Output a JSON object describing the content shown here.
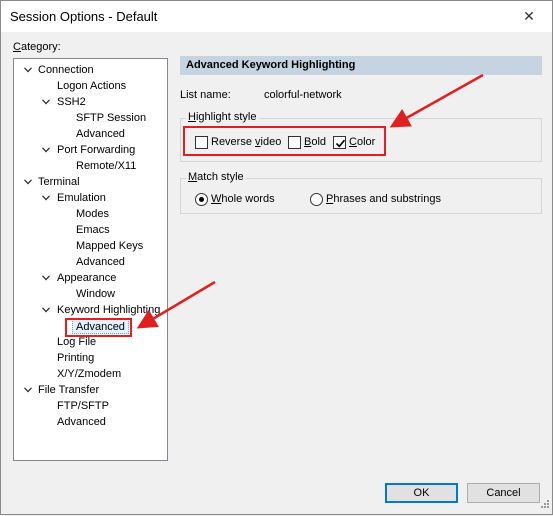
{
  "window": {
    "title": "Session Options - Default",
    "close_glyph": "✕"
  },
  "category": {
    "prefix": "",
    "accel": "C",
    "rest": "ategory:"
  },
  "tree": [
    {
      "label": "Connection",
      "level": 0,
      "expanded": true
    },
    {
      "label": "Logon Actions",
      "level": 1
    },
    {
      "label": "SSH2",
      "level": 1,
      "expanded": true
    },
    {
      "label": "SFTP Session",
      "level": 2
    },
    {
      "label": "Advanced",
      "level": 2
    },
    {
      "label": "Port Forwarding",
      "level": 1,
      "expanded": true
    },
    {
      "label": "Remote/X11",
      "level": 2
    },
    {
      "label": "Terminal",
      "level": 0,
      "expanded": true
    },
    {
      "label": "Emulation",
      "level": 1,
      "expanded": true
    },
    {
      "label": "Modes",
      "level": 2
    },
    {
      "label": "Emacs",
      "level": 2
    },
    {
      "label": "Mapped Keys",
      "level": 2
    },
    {
      "label": "Advanced",
      "level": 2
    },
    {
      "label": "Appearance",
      "level": 1,
      "expanded": true
    },
    {
      "label": "Window",
      "level": 2
    },
    {
      "label": "Keyword Highlighting",
      "level": 1,
      "expanded": true
    },
    {
      "label": "Advanced",
      "level": 2,
      "selected": true
    },
    {
      "label": "Log File",
      "level": 1
    },
    {
      "label": "Printing",
      "level": 1
    },
    {
      "label": "X/Y/Zmodem",
      "level": 1
    },
    {
      "label": "File Transfer",
      "level": 0,
      "expanded": true
    },
    {
      "label": "FTP/SFTP",
      "level": 1
    },
    {
      "label": "Advanced",
      "level": 1
    }
  ],
  "panel": {
    "header": "Advanced Keyword Highlighting",
    "list_name_label": "List name:",
    "list_name_value": "colorful-network",
    "highlight_style": {
      "label_accel": "H",
      "label_rest": "ighlight style",
      "reverse_pre": "Reverse ",
      "reverse_accel": "v",
      "reverse_post": "ideo",
      "reverse_checked": false,
      "bold_accel": "B",
      "bold_rest": "old",
      "bold_checked": false,
      "color_accel": "C",
      "color_rest": "olor",
      "color_checked": true
    },
    "match_style": {
      "label_accel": "M",
      "label_rest": "atch style",
      "whole_accel": "W",
      "whole_rest": "hole words",
      "whole_selected": true,
      "phrases_accel": "P",
      "phrases_rest": "hrases and substrings",
      "phrases_selected": false
    }
  },
  "buttons": {
    "ok": "OK",
    "cancel": "Cancel"
  },
  "colors": {
    "annotation": "#e02020",
    "header_bg": "#c6d3e0",
    "ok_border": "#0078d7"
  }
}
